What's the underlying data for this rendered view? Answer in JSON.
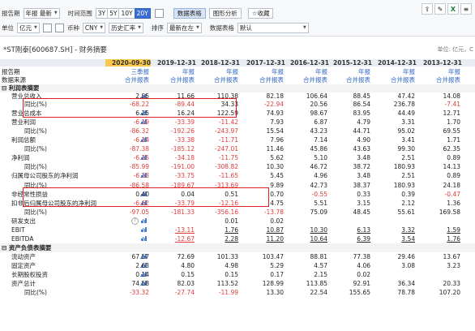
{
  "toolbar": {
    "period_label": "报告期",
    "period_value": "年报 最新",
    "time_label": "时间范围",
    "time_opts": [
      "3Y",
      "5Y",
      "10Y",
      "20Y"
    ],
    "time_active": "20Y",
    "tab_data": "数据表格",
    "tab_chart": "图形分析",
    "fav": "收藏",
    "unit_label": "单位",
    "unit_value": "亿元",
    "currency_label": "币种",
    "currency_value": "CNY",
    "rate_value": "历史汇率",
    "sort_label": "排序",
    "sort_value": "最新在左",
    "table_label": "数据表格",
    "table_value": "默认"
  },
  "page": {
    "title": "*ST刚泰[600687.SH] - 财务摘要",
    "unit_note": "单位: 亿元，C"
  },
  "columns": [
    "2020-09-30",
    "2019-12-31",
    "2018-12-31",
    "2017-12-31",
    "2016-12-31",
    "2015-12-31",
    "2014-12-31",
    "2013-12-31"
  ],
  "rows": [
    {
      "name": "报告期",
      "lvl": 2,
      "plain": 1,
      "vals": [
        "三季报",
        "年报",
        "年报",
        "年报",
        "年报",
        "年报",
        "年报",
        "年报"
      ]
    },
    {
      "name": "数据来源",
      "lvl": 2,
      "plain": 1,
      "vals": [
        "合并报表",
        "合并报表",
        "合并报表",
        "合并报表",
        "合并报表",
        "合并报表",
        "合并报表",
        "合并报表"
      ]
    },
    {
      "name": "利润表摘要",
      "lvl": 0,
      "sec": 1,
      "vals": []
    },
    {
      "name": "营业总收入",
      "lvl": 1,
      "spark": 1,
      "vals": [
        "2.95",
        "11.66",
        "110.38",
        "82.18",
        "106.64",
        "88.45",
        "47.42",
        "14.08"
      ]
    },
    {
      "name": "同比(%)",
      "lvl": 2,
      "vals": [
        "-68.22",
        "-89.44",
        "34.33",
        "-22.94",
        "20.56",
        "86.54",
        "236.78",
        "-7.41"
      ]
    },
    {
      "name": "营业总成本",
      "lvl": 1,
      "spark": 1,
      "vals": [
        "6.25",
        "16.24",
        "122.59",
        "74.93",
        "98.67",
        "83.95",
        "44.49",
        "12.71"
      ]
    },
    {
      "name": "营业利润",
      "lvl": 1,
      "spark": 1,
      "vals": [
        "-6.19",
        "-33.39",
        "-11.42",
        "7.93",
        "6.87",
        "4.79",
        "3.31",
        "1.70"
      ]
    },
    {
      "name": "同比(%)",
      "lvl": 2,
      "vals": [
        "-86.32",
        "-192.26",
        "-243.97",
        "15.54",
        "43.23",
        "44.71",
        "95.02",
        "69.55"
      ]
    },
    {
      "name": "利润总额",
      "lvl": 1,
      "spark": 1,
      "vals": [
        "-6.24",
        "-33.38",
        "-11.71",
        "7.96",
        "7.14",
        "4.90",
        "3.41",
        "1.71"
      ]
    },
    {
      "name": "同比(%)",
      "lvl": 2,
      "vals": [
        "-87.38",
        "-185.12",
        "-247.01",
        "11.46",
        "45.86",
        "43.63",
        "99.30",
        "62.35"
      ]
    },
    {
      "name": "净利润",
      "lvl": 1,
      "spark": 1,
      "vals": [
        "-6.25",
        "-34.18",
        "-11.75",
        "5.62",
        "5.10",
        "3.48",
        "2.51",
        "0.89"
      ]
    },
    {
      "name": "同比(%)",
      "lvl": 2,
      "vals": [
        "-85.99",
        "-191.00",
        "-308.82",
        "10.30",
        "46.72",
        "38.72",
        "180.93",
        "14.13"
      ]
    },
    {
      "name": "归属母公司股东的净利润",
      "lvl": 1,
      "spark": 1,
      "vals": [
        "-6.23",
        "-33.75",
        "-11.65",
        "5.45",
        "4.96",
        "3.48",
        "2.51",
        "0.89"
      ]
    },
    {
      "name": "同比(%)",
      "lvl": 2,
      "vals": [
        "-86.58",
        "-189.67",
        "-313.69",
        "9.89",
        "42.73",
        "38.37",
        "180.93",
        "24.18"
      ]
    },
    {
      "name": "非经常性损益",
      "lvl": 1,
      "spark": 1,
      "vals": [
        "0.40",
        "0.04",
        "0.51",
        "0.70",
        "-0.55",
        "0.33",
        "0.39",
        "-0.47"
      ]
    },
    {
      "name": "扣非后归属母公司股东的净利润",
      "lvl": 1,
      "spark": 1,
      "vals": [
        "-6.62",
        "-33.79",
        "-12.16",
        "4.75",
        "5.51",
        "3.15",
        "2.12",
        "1.36"
      ]
    },
    {
      "name": "同比(%)",
      "lvl": 2,
      "vals": [
        "-97.05",
        "-181.33",
        "-356.16",
        "-13.78",
        "75.09",
        "48.45",
        "55.61",
        "169.58"
      ]
    },
    {
      "name": "研发支出",
      "lvl": 1,
      "spark": 1,
      "help": 1,
      "vals": [
        "",
        "",
        "0.01",
        "0.02",
        "",
        "",
        "",
        ""
      ]
    },
    {
      "name": "EBIT",
      "lvl": 1,
      "spark": 1,
      "vals": [
        "",
        "-13.11",
        "1.76",
        "10.87",
        "10.30",
        "6.13",
        "3.32",
        "1.59"
      ],
      "links": 1
    },
    {
      "name": "EBITDA",
      "lvl": 1,
      "spark": 1,
      "vals": [
        "",
        "-12.67",
        "2.28",
        "11.20",
        "10.64",
        "6.39",
        "3.54",
        "1.76"
      ],
      "links": 1
    },
    {
      "name": "资产负债表摘要",
      "lvl": 0,
      "sec": 1,
      "vals": []
    },
    {
      "name": "流动资产",
      "lvl": 1,
      "spark": 1,
      "vals": [
        "67.57",
        "72.69",
        "101.33",
        "103.47",
        "88.81",
        "77.38",
        "29.46",
        "13.67"
      ]
    },
    {
      "name": "固定资产",
      "lvl": 1,
      "spark": 1,
      "vals": [
        "2.63",
        "4.80",
        "4.98",
        "5.29",
        "4.57",
        "4.06",
        "3.08",
        "3.23"
      ]
    },
    {
      "name": "长期股权投资",
      "lvl": 1,
      "spark": 1,
      "vals": [
        "0.14",
        "0.15",
        "0.15",
        "0.17",
        "2.15",
        "0.02",
        "",
        ""
      ]
    },
    {
      "name": "资产总计",
      "lvl": 1,
      "spark": 1,
      "vals": [
        "74.58",
        "82.03",
        "113.52",
        "128.99",
        "113.85",
        "92.91",
        "36.34",
        "20.33"
      ]
    },
    {
      "name": "同比(%)",
      "lvl": 2,
      "vals": [
        "-33.32",
        "-27.74",
        "-11.99",
        "13.30",
        "22.54",
        "155.65",
        "78.78",
        "107.20"
      ]
    }
  ]
}
